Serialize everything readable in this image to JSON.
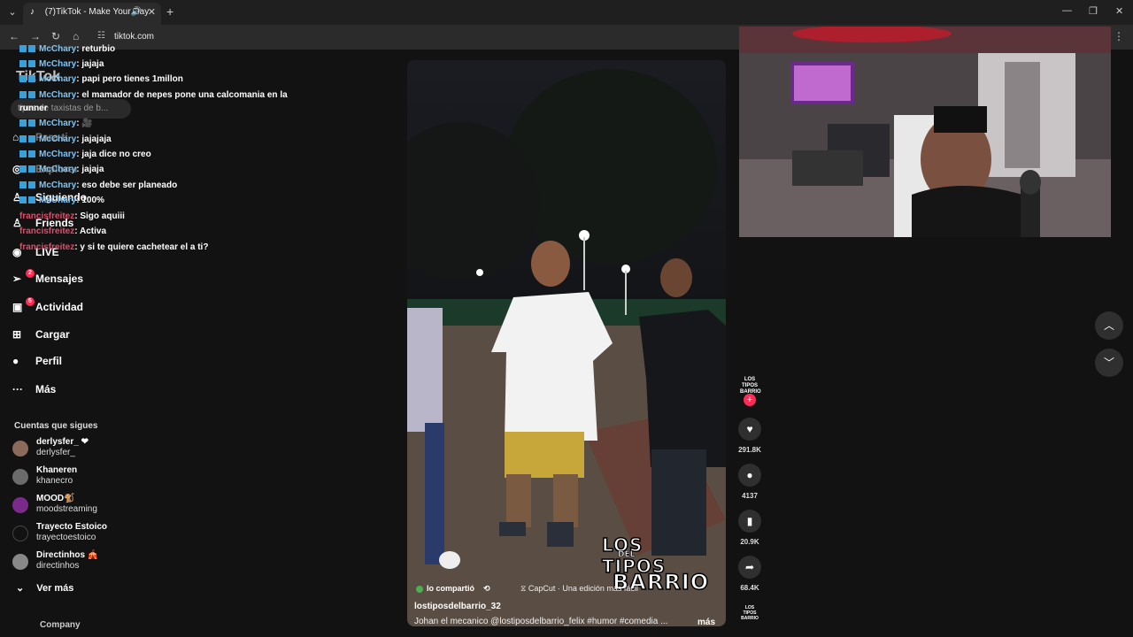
{
  "browser": {
    "tab_title": "(7)TikTok - Make Your Day",
    "url": "tiktok.com"
  },
  "sidebar": {
    "logo": "TikTok",
    "search_placeholder": "tipos de taxistas de b...",
    "nav": [
      {
        "label": "Para ti",
        "icon": "home-icon"
      },
      {
        "label": "Explorar",
        "icon": "compass-icon"
      },
      {
        "label": "Siguiendo",
        "icon": "following-icon"
      },
      {
        "label": "Friends",
        "icon": "friends-icon"
      },
      {
        "label": "LIVE",
        "icon": "live-icon"
      },
      {
        "label": "Mensajes",
        "icon": "messages-icon",
        "badge": "2"
      },
      {
        "label": "Actividad",
        "icon": "activity-icon",
        "badge": "5"
      },
      {
        "label": "Cargar",
        "icon": "upload-icon"
      },
      {
        "label": "Perfil",
        "icon": "profile-icon"
      },
      {
        "label": "Más",
        "icon": "more-icon"
      }
    ],
    "following_title": "Cuentas que sigues",
    "accounts": [
      {
        "name": "derlysfer_ ❤",
        "handle": "derlysfer_",
        "color": "#8a6a5a"
      },
      {
        "name": "Khaneren",
        "handle": "khanecro",
        "color": "#6b6b6b"
      },
      {
        "name": "MOOD🐒",
        "handle": "moodstreaming",
        "color": "#7a2a8a"
      },
      {
        "name": "Trayecto Estoico",
        "handle": "trayectoestoico",
        "color": "#121212"
      },
      {
        "name": "Directinhos 🎪",
        "handle": "directinhos",
        "color": "#888888"
      }
    ],
    "see_more": "Ver más",
    "company": "Company"
  },
  "chat": [
    {
      "user": "McChary",
      "msg": ": returbio"
    },
    {
      "user": "McChary",
      "msg": ": jajaja"
    },
    {
      "user": "McChary",
      "msg": ": papi pero tienes 1millon"
    },
    {
      "user": "McChary",
      "msg": ": el mamador de nepes pone una calcomania en la"
    },
    {
      "user": "",
      "msg": "runner"
    },
    {
      "user": "McChary",
      "msg": ": 🎥"
    },
    {
      "user": "McChary",
      "msg": ": jajajaja"
    },
    {
      "user": "McChary",
      "msg": ": jaja dice no creo"
    },
    {
      "user": "McChary",
      "msg": ": jajaja"
    },
    {
      "user": "McChary",
      "msg": ": eso debe ser planeado"
    },
    {
      "user": "McChary",
      "msg": ": 100%"
    },
    {
      "user": "francisfreitez",
      "msg": ": Sigo aquiii"
    },
    {
      "user": "francisfreitez",
      "msg": ": Activa"
    },
    {
      "user": "francisfreitez",
      "msg": ": y si te quiere cachetear el a ti?"
    }
  ],
  "video": {
    "shared_text": "lo compartió",
    "capcut_text": "CapCut · Una edición más fácil",
    "username": "lostiposdelbarrio_32",
    "caption": "Johan el mecanico  @lostiposdelbarrio_felix  #humor  #comedia  ...",
    "more": "más",
    "watermark_1": "LOS TIPOS",
    "watermark_2": "DEL",
    "watermark_3": "BARRIO"
  },
  "actions": {
    "author_badge": "LOS TIPOS BARRIO",
    "likes": "291.8K",
    "comments": "4137",
    "saves": "20.9K",
    "shares": "68.4K"
  }
}
